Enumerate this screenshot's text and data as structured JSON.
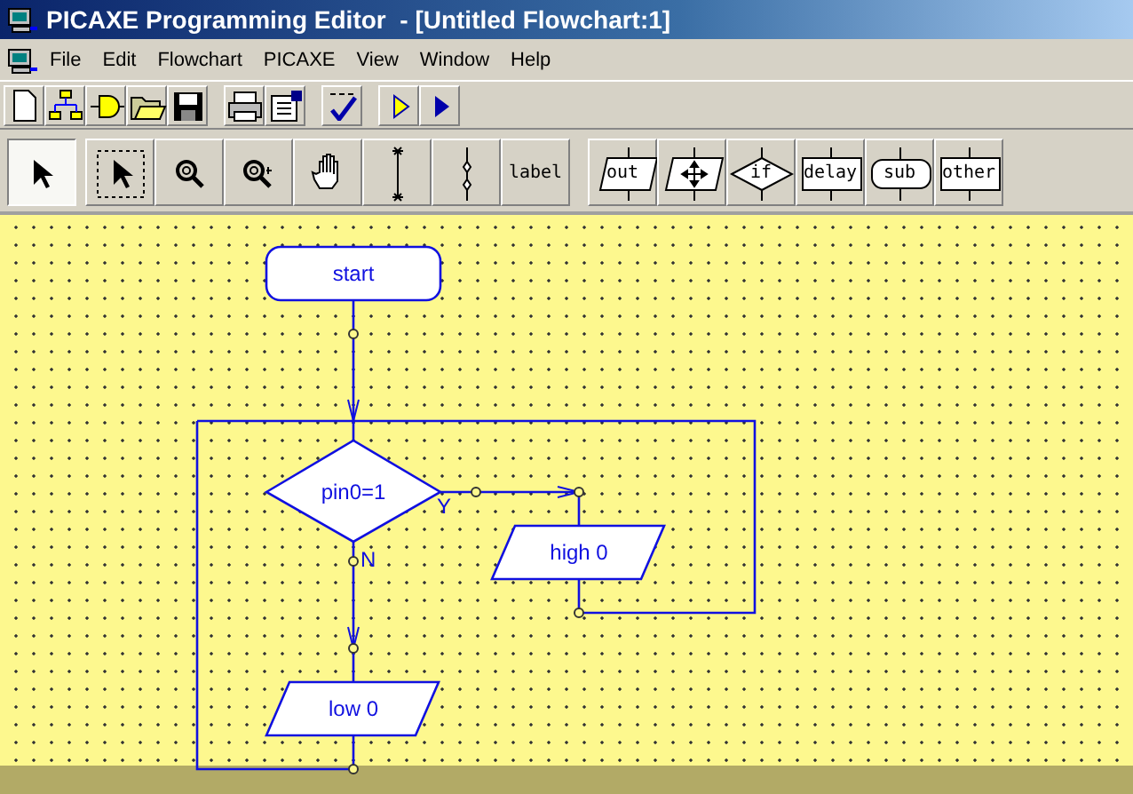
{
  "window": {
    "title": "PICAXE Programming Editor  - [Untitled Flowchart:1]"
  },
  "menu": [
    "File",
    "Edit",
    "Flowchart",
    "PICAXE",
    "View",
    "Window",
    "Help"
  ],
  "palette": [
    {
      "kind": "pointer",
      "selected": true
    },
    {
      "kind": "select",
      "selected": false
    },
    {
      "kind": "zoom",
      "selected": false
    },
    {
      "kind": "zoom-area",
      "selected": false
    },
    {
      "kind": "pan",
      "selected": false
    },
    {
      "kind": "line",
      "selected": false
    },
    {
      "kind": "connect",
      "selected": false
    },
    {
      "kind": "label",
      "label": "label",
      "selected": false
    },
    {
      "kind": "out",
      "label": "out",
      "selected": false
    },
    {
      "kind": "move",
      "selected": false
    },
    {
      "kind": "if",
      "label": "if",
      "selected": false
    },
    {
      "kind": "delay",
      "label": "delay",
      "selected": false
    },
    {
      "kind": "sub",
      "label": "sub",
      "selected": false
    },
    {
      "kind": "other",
      "label": "other",
      "selected": false
    }
  ],
  "flowchart": {
    "nodes": [
      {
        "kind": "terminal",
        "text": "start"
      },
      {
        "kind": "decision",
        "text": "pin0=1",
        "yes_label": "Y",
        "no_label": "N"
      },
      {
        "kind": "io",
        "text": "high 0"
      },
      {
        "kind": "io",
        "text": "low 0"
      }
    ]
  }
}
